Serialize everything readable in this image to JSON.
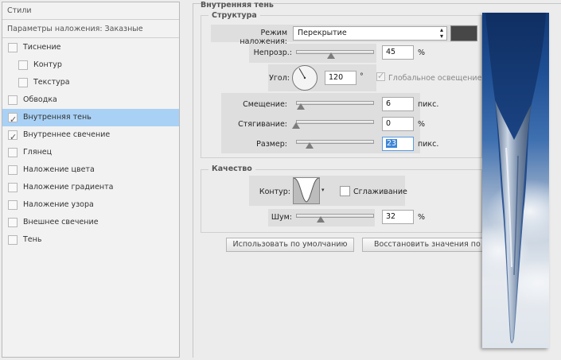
{
  "left_panel": {
    "header_styles": "Стили",
    "header_blend": "Параметры наложения: Заказные",
    "items": [
      {
        "label": "Тиснение",
        "checked": false,
        "indent": false,
        "active": false
      },
      {
        "label": "Контур",
        "checked": false,
        "indent": true,
        "active": false
      },
      {
        "label": "Текстура",
        "checked": false,
        "indent": true,
        "active": false
      },
      {
        "label": "Обводка",
        "checked": false,
        "indent": false,
        "active": false
      },
      {
        "label": "Внутренняя тень",
        "checked": true,
        "indent": false,
        "active": true
      },
      {
        "label": "Внутреннее свечение",
        "checked": true,
        "indent": false,
        "active": false
      },
      {
        "label": "Глянец",
        "checked": false,
        "indent": false,
        "active": false
      },
      {
        "label": "Наложение цвета",
        "checked": false,
        "indent": false,
        "active": false
      },
      {
        "label": "Наложение градиента",
        "checked": false,
        "indent": false,
        "active": false
      },
      {
        "label": "Наложение узора",
        "checked": false,
        "indent": false,
        "active": false
      },
      {
        "label": "Внешнее свечение",
        "checked": false,
        "indent": false,
        "active": false
      },
      {
        "label": "Тень",
        "checked": false,
        "indent": false,
        "active": false
      }
    ]
  },
  "dialog": {
    "title": "Внутренняя тень",
    "structure": {
      "title": "Структура",
      "blend_mode_label": "Режим наложения:",
      "blend_mode_value": "Перекрытие",
      "shadow_color": "#474747",
      "opacity_label": "Непрозр.:",
      "opacity_value": "45",
      "opacity_unit": "%",
      "opacity_level": 0.45,
      "angle_label": "Угол:",
      "angle_value": "120",
      "angle_unit": "°",
      "global_light_label": "Глобальное освещение",
      "global_light_checked": true,
      "distance_label": "Смещение:",
      "distance_value": "6",
      "distance_unit": "пикс.",
      "choke_label": "Стягивание:",
      "choke_value": "0",
      "choke_unit": "%",
      "size_label": "Размер:",
      "size_value": "23",
      "size_unit": "пикс."
    },
    "quality": {
      "title": "Качество",
      "contour_label": "Контур:",
      "antialias_label": "Сглаживание",
      "antialias_checked": false,
      "noise_label": "Шум:",
      "noise_value": "32",
      "noise_unit": "%",
      "noise_level": 0.32
    },
    "buttons": {
      "make_default": "Использовать по умолчанию",
      "reset_default": "Восстановить значения по умолчанию"
    }
  }
}
